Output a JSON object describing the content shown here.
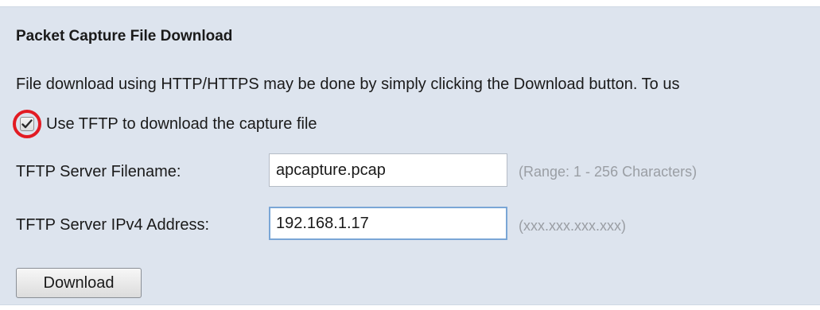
{
  "section": {
    "title": "Packet Capture File Download",
    "description": "File download using HTTP/HTTPS may be done by simply clicking the Download button. To us"
  },
  "tftp_checkbox": {
    "label": "Use TFTP to download the capture file",
    "checked": true,
    "highlight_color": "#e21b23"
  },
  "filename_field": {
    "label": "TFTP Server Filename:",
    "value": "apcapture.pcap",
    "hint": "(Range: 1 - 256 Characters)"
  },
  "ipv4_field": {
    "label": "TFTP Server IPv4 Address:",
    "value": "192.168.1.17",
    "hint": "(xxx.xxx.xxx.xxx)"
  },
  "actions": {
    "download_label": "Download"
  },
  "colors": {
    "panel_background": "#dde4ee",
    "focus_border": "#7aa6d6",
    "hint_text": "#9a9ea4"
  }
}
